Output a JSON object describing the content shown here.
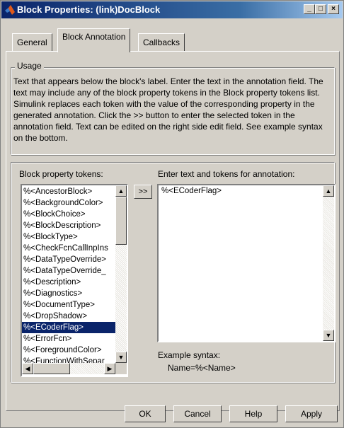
{
  "window": {
    "title": "Block Properties: (link)DocBlock"
  },
  "tabs": [
    {
      "label": "General"
    },
    {
      "label": "Block Annotation"
    },
    {
      "label": "Callbacks"
    }
  ],
  "usage": {
    "legend": "Usage",
    "text": "Text that appears below the block's label. Enter the text in the annotation field. The text may include any of the block property tokens in the Block property tokens list. Simulink replaces each token with the value of the corresponding property in the generated annotation. Click the >> button to enter the selected token in the annotation field. Text can be edited on the right side edit field. See example syntax on the bottom."
  },
  "tokens": {
    "label": "Block property tokens:",
    "selected": "%<ECoderFlag>",
    "items": [
      "%<AncestorBlock>",
      "%<BackgroundColor>",
      "%<BlockChoice>",
      "%<BlockDescription>",
      "%<BlockType>",
      "%<CheckFcnCallInpIns",
      "%<DataTypeOverride>",
      "%<DataTypeOverride_",
      "%<Description>",
      "%<Diagnostics>",
      "%<DocumentType>",
      "%<DropShadow>",
      "%<ECoderFlag>",
      "%<ErrorFcn>",
      "%<ForegroundColor>",
      "%<FunctionWithSepar"
    ]
  },
  "insert_button": ">>",
  "annotation": {
    "label": "Enter text and tokens for annotation:",
    "value": "%<ECoderFlag>",
    "example_label": "Example syntax:",
    "example_value": "Name=%<Name>"
  },
  "buttons": {
    "ok": "OK",
    "cancel": "Cancel",
    "help": "Help",
    "apply": "Apply"
  },
  "icons": [
    "matlab-logo-icon",
    "minimize-icon",
    "maximize-icon",
    "close-icon",
    "scroll-up-icon",
    "scroll-down-icon",
    "scroll-left-icon",
    "scroll-right-icon"
  ]
}
